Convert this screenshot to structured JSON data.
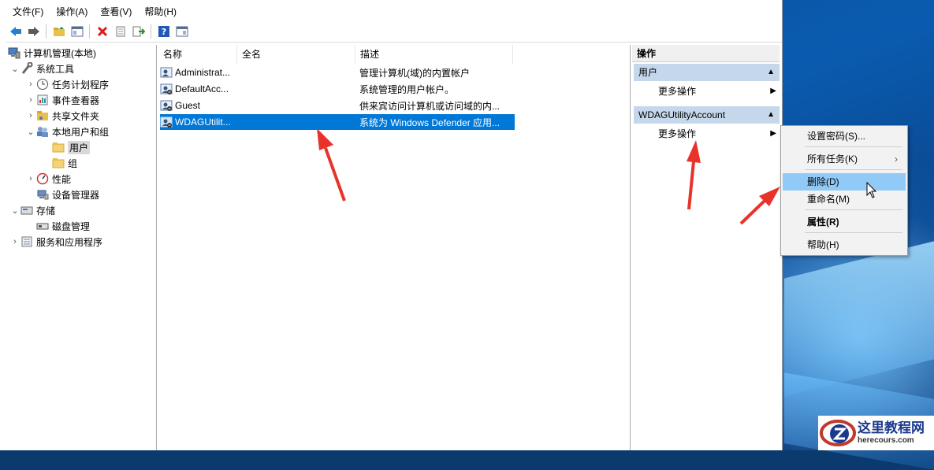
{
  "menubar": {
    "items": [
      "文件(F)",
      "操作(A)",
      "查看(V)",
      "帮助(H)"
    ]
  },
  "toolbar": {
    "icons": [
      "back-icon",
      "forward-icon",
      "up-folder-icon",
      "show-hide-tree-icon",
      "delete-icon",
      "properties-icon",
      "export-icon",
      "help-icon",
      "show-hide-action-pane-icon"
    ]
  },
  "tree": {
    "root": "计算机管理(本地)",
    "system_tools": "系统工具",
    "task_scheduler": "任务计划程序",
    "event_viewer": "事件查看器",
    "shared_folders": "共享文件夹",
    "local_users_groups": "本地用户和组",
    "users": "用户",
    "groups": "组",
    "performance": "性能",
    "device_manager": "设备管理器",
    "storage": "存储",
    "disk_management": "磁盘管理",
    "services_apps": "服务和应用程序"
  },
  "list": {
    "columns": [
      "名称",
      "全名",
      "描述"
    ],
    "rows": [
      {
        "name": "Administrat...",
        "fullname": "",
        "description": "管理计算机(域)的内置帐户"
      },
      {
        "name": "DefaultAcc...",
        "fullname": "",
        "description": "系统管理的用户帐户。"
      },
      {
        "name": "Guest",
        "fullname": "",
        "description": "供来宾访问计算机或访问域的内..."
      },
      {
        "name": "WDAGUtilit...",
        "fullname": "",
        "description": "系统为 Windows Defender 应用..."
      }
    ]
  },
  "actions": {
    "title": "操作",
    "group1_title": "用户",
    "group1_more": "更多操作",
    "group2_title": "WDAGUtilityAccount",
    "group2_more": "更多操作"
  },
  "context_menu": {
    "set_password": "设置密码(S)...",
    "all_tasks": "所有任务(K)",
    "delete": "删除(D)",
    "rename": "重命名(M)",
    "properties": "属性(R)",
    "help": "帮助(H)"
  },
  "watermark": {
    "name_cn": "这里教程网",
    "url": "herecours.com"
  },
  "colors": {
    "selection": "#0078d7",
    "group_header": "#c5d7ea",
    "menu_hover": "#91c9f7",
    "annotation_arrow": "#e8332a"
  }
}
